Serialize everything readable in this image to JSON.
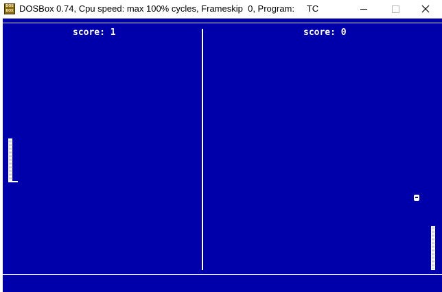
{
  "window": {
    "icon_text": "DOS BOX",
    "title": "DOSBox 0.74, Cpu speed: max 100% cycles, Frameskip  0, Program:     TC",
    "minimize_label": "Minimize",
    "maximize_label": "Maximize",
    "close_label": "Close"
  },
  "game": {
    "left_score_label": "score: 1",
    "right_score_label": "score: 0",
    "left_score": 1,
    "right_score": 0
  },
  "colors": {
    "screen_background": "#0000aa",
    "foreground": "#ffffff"
  }
}
